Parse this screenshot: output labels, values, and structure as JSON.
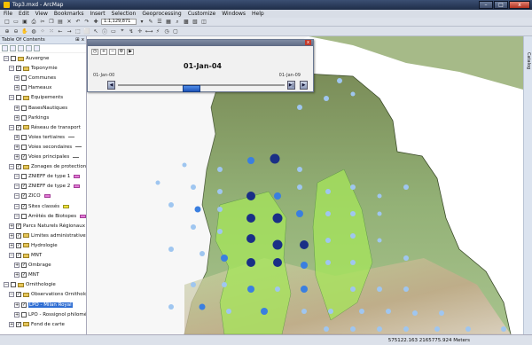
{
  "window": {
    "title": "Top3.mxd - ArcMap",
    "controls": {
      "minimize": "–",
      "maximize": "□",
      "close": "x"
    }
  },
  "menu": [
    "File",
    "Edit",
    "View",
    "Bookmarks",
    "Insert",
    "Selection",
    "Geoprocessing",
    "Customize",
    "Windows",
    "Help"
  ],
  "toolbar": {
    "scale": "1:1,129,871"
  },
  "toc": {
    "title": "Table Of Contents",
    "ctrl_pin": "⊞",
    "ctrl_close": "x",
    "rows": [
      {
        "label": "Auvergne",
        "exp": "−",
        "check": false,
        "group": true
      },
      {
        "label": "Toponymie",
        "exp": "−",
        "check": true,
        "group": true
      },
      {
        "label": "Communes",
        "exp": "+",
        "check": false
      },
      {
        "label": "Hameaux",
        "exp": "+",
        "check": false
      },
      {
        "label": "Equipements",
        "exp": "−",
        "check": false,
        "group": true
      },
      {
        "label": "BasesNautiques",
        "exp": "+",
        "check": false
      },
      {
        "label": "Parkings",
        "exp": "+",
        "check": false
      },
      {
        "label": "Réseau de transport",
        "exp": "−",
        "check": true,
        "group": true
      },
      {
        "label": "Voies tertiaires",
        "exp": "+",
        "check": false
      },
      {
        "label": "Voies secondaires",
        "exp": "+",
        "check": false
      },
      {
        "label": "Voies principales",
        "exp": "+",
        "check": true
      },
      {
        "label": "Zonages de protection environnemental",
        "exp": "−",
        "check": true,
        "group": true
      },
      {
        "label": "ZNIEFF de type 1",
        "exp": "−",
        "check": false
      },
      {
        "label": "ZNIEFF de type 2",
        "exp": "−",
        "check": true
      },
      {
        "label": "ZICO",
        "exp": "−",
        "check": true
      },
      {
        "label": "Sites classés",
        "exp": "−",
        "check": true
      },
      {
        "label": "Arrêtés de Biotopes",
        "exp": "−",
        "check": false
      },
      {
        "label": "Parcs Naturels Régionaux",
        "exp": "+",
        "check": true
      },
      {
        "label": "Limites administratives",
        "exp": "+",
        "check": true,
        "group": true
      },
      {
        "label": "Hydrologie",
        "exp": "+",
        "check": true,
        "group": true
      },
      {
        "label": "MNT",
        "exp": "−",
        "check": true,
        "group": true
      },
      {
        "label": "Ombrage",
        "exp": "+",
        "check": true
      },
      {
        "label": "MNT",
        "exp": "+",
        "check": true
      },
      {
        "label": "Ornithologie",
        "exp": "−",
        "check": false,
        "group": true
      },
      {
        "label": "Observations Ornithologiques",
        "exp": "−",
        "check": true,
        "group": true
      },
      {
        "label": "LPO - Milan Royal",
        "exp": "+",
        "check": true,
        "selected": true
      },
      {
        "label": "LPO - Rossignol philomèle",
        "exp": "+",
        "check": false
      },
      {
        "label": "Fond de carte",
        "exp": "+",
        "check": true,
        "group": true
      }
    ]
  },
  "time_slider": {
    "current_date": "01-Jan-04",
    "start_label": "01-Jan-00",
    "end_label": "01-Jan-09",
    "prev_btn": "◀",
    "next_btn": "▶",
    "play_btn": "▶",
    "first_btn": "|◀",
    "last_btn": "▶|",
    "progress": 0.44
  },
  "status": {
    "coords": "575122.163  2165775.924 Meters"
  },
  "catalog_tab": "Catalog",
  "colors": {
    "terrain_light": "#a4ce8c",
    "terrain_dark": "#5a6d3e",
    "park_green": "#a6e65a",
    "dot_light": "#9fc6f0",
    "dot_mid": "#3a7fe0",
    "dot_dark": "#1a2f86"
  },
  "observations": [
    {
      "size": "large",
      "count": 2
    },
    {
      "size": "medium",
      "count": 3
    }
  ]
}
